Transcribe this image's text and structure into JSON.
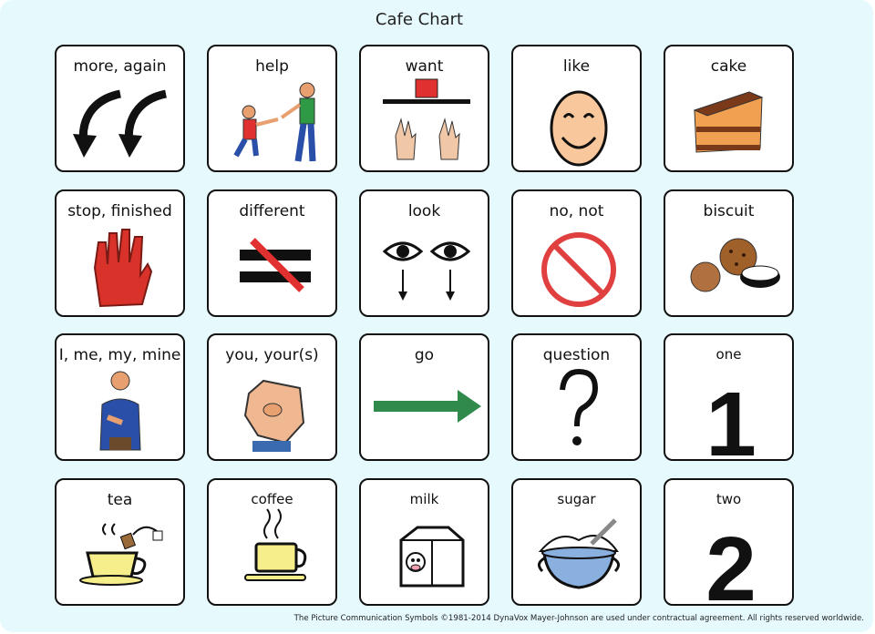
{
  "title": "Cafe Chart",
  "cells": [
    {
      "label": "more, again",
      "icon": "curved-arrows-icon"
    },
    {
      "label": "help",
      "icon": "helping-people-icon"
    },
    {
      "label": "want",
      "icon": "reaching-hands-icon"
    },
    {
      "label": "like",
      "icon": "smiling-face-icon"
    },
    {
      "label": "cake",
      "icon": "cake-slice-icon"
    },
    {
      "label": "stop, finished",
      "icon": "red-hand-icon"
    },
    {
      "label": "different",
      "icon": "not-equal-icon"
    },
    {
      "label": "look",
      "icon": "eyes-icon"
    },
    {
      "label": "no, not",
      "icon": "prohibited-icon"
    },
    {
      "label": "biscuit",
      "icon": "biscuits-icon"
    },
    {
      "label": "I, me, my, mine",
      "icon": "person-pointing-self-icon"
    },
    {
      "label": "you, your(s)",
      "icon": "pointing-finger-icon"
    },
    {
      "label": "go",
      "icon": "green-arrow-icon"
    },
    {
      "label": "question",
      "icon": "question-mark-icon"
    },
    {
      "label": "one",
      "icon": "number-one-icon",
      "value": "1"
    },
    {
      "label": "tea",
      "icon": "tea-cup-icon"
    },
    {
      "label": "coffee",
      "icon": "coffee-cup-icon"
    },
    {
      "label": "milk",
      "icon": "milk-carton-icon"
    },
    {
      "label": "sugar",
      "icon": "sugar-bowl-icon"
    },
    {
      "label": "two",
      "icon": "number-two-icon",
      "value": "2"
    }
  ],
  "footer": "The Picture Communication Symbols ©1981-2014 DynaVox Mayer-Johnson are used under contractual agreement.  All rights reserved worldwide."
}
